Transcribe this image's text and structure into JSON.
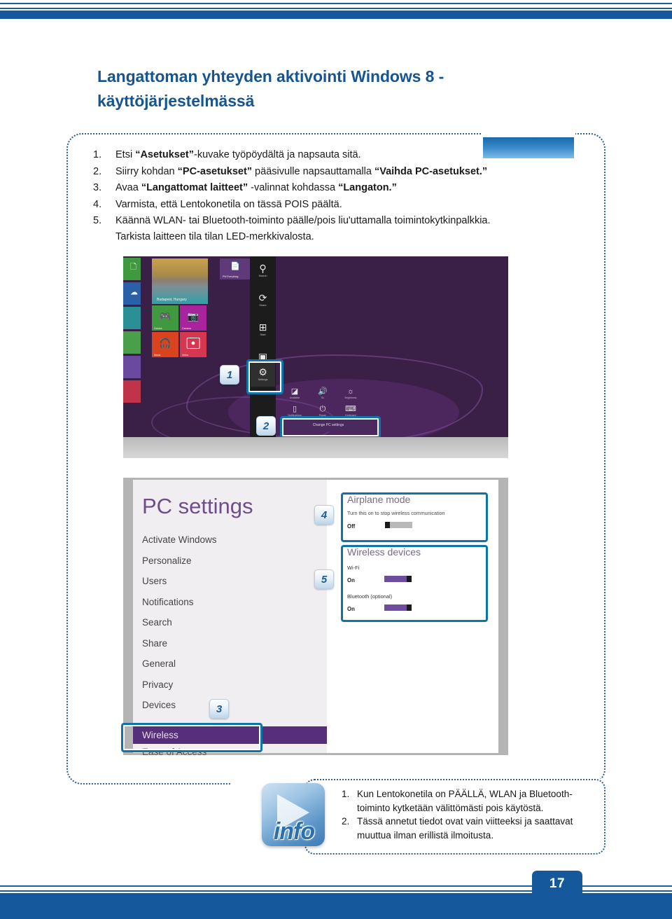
{
  "page": {
    "number": "17",
    "title": "Langattoman yhteyden aktivointi Windows 8 - käyttöjärjestelmässä"
  },
  "steps": [
    {
      "num": "1.",
      "html": "Etsi <b>“Asetukset”</b>-kuvake työpöydältä ja napsauta sitä."
    },
    {
      "num": "2.",
      "html": "Siirry kohdan <b>“PC-asetukset”</b> pääsivulle napsauttamalla <b>“Vaihda PC-asetukset.”</b>"
    },
    {
      "num": "3.",
      "html": "Avaa <b>“Langattomat laitteet”</b> -valinnat kohdassa <b>“Langaton.”</b>"
    },
    {
      "num": "4.",
      "html": "Varmista, että Lentokonetila on tässä POIS päältä."
    },
    {
      "num": "5.",
      "html": "Käännä WLAN- tai Bluetooth-toiminto päälle/pois liu'uttamalla toimintokytkinpalkkia."
    }
  ],
  "step5_continued": "Tarkista laitteen tila tilan LED-merkkivalosta.",
  "win8": {
    "badges": {
      "one": "1",
      "two": "2"
    },
    "charms": [
      {
        "icon": "search-icon",
        "glyph": "⚲",
        "label": "Search"
      },
      {
        "icon": "share-icon",
        "glyph": "⟳",
        "label": "Share"
      },
      {
        "icon": "start-icon",
        "glyph": "⊞",
        "label": "Start"
      },
      {
        "icon": "devices-icon",
        "glyph": "▣",
        "label": "Devices"
      },
      {
        "icon": "settings-gear-icon",
        "glyph": "⚙",
        "label": "Settings"
      }
    ],
    "quick_settings": [
      {
        "icon": "network-icon",
        "glyph": "◢",
        "label": "Available"
      },
      {
        "icon": "volume-icon",
        "glyph": "ὐA",
        "label": "51"
      },
      {
        "icon": "brightness-icon",
        "glyph": "☀",
        "label": "Brightness"
      },
      {
        "icon": "notifications-icon",
        "glyph": "▭",
        "label": "Notifications"
      },
      {
        "icon": "power-icon",
        "glyph": "⏻",
        "label": "Power"
      },
      {
        "icon": "keyboard-icon",
        "glyph": "⌨",
        "label": "Keyboard"
      }
    ],
    "change_pc_settings": "Change PC settings",
    "tiles": {
      "wide": "Budapest, Hungary",
      "pinned": "PW Everything",
      "small": [
        "Games",
        "Camera",
        "Music",
        "Video"
      ]
    }
  },
  "pcsettings": {
    "badges": {
      "three": "3",
      "four": "4",
      "five": "5"
    },
    "title": "PC settings",
    "nav": [
      "Activate Windows",
      "Personalize",
      "Users",
      "Notifications",
      "Search",
      "Share",
      "General",
      "Privacy",
      "Devices"
    ],
    "selected": "Wireless",
    "last": "Ease of Access",
    "airplane": {
      "title": "Airplane mode",
      "desc": "Turn this on to stop wireless communication",
      "state": "Off"
    },
    "wireless_devices": {
      "title": "Wireless devices",
      "rows": [
        {
          "label": "Wi-Fi",
          "state": "On"
        },
        {
          "label": "Bluetooth (optional)",
          "state": "On"
        }
      ]
    }
  },
  "info": {
    "icon_word": "info",
    "notes": [
      {
        "num": "1.",
        "text": "Kun Lentokonetila on PÄÄLLÄ, WLAN ja Bluetooth-toiminto kytketään välittömästi pois käytöstä."
      },
      {
        "num": "2.",
        "text": "Tässä annetut tiedot ovat vain viitteeksi ja saattavat muuttua ilman erillistä ilmoitusta."
      }
    ]
  },
  "colors": {
    "brand_blue": "#15599c",
    "title_blue": "#16558f",
    "highlight_blue": "#1074a8",
    "purple_accent": "#562e79",
    "toggle_on": "#6f4d9e"
  }
}
